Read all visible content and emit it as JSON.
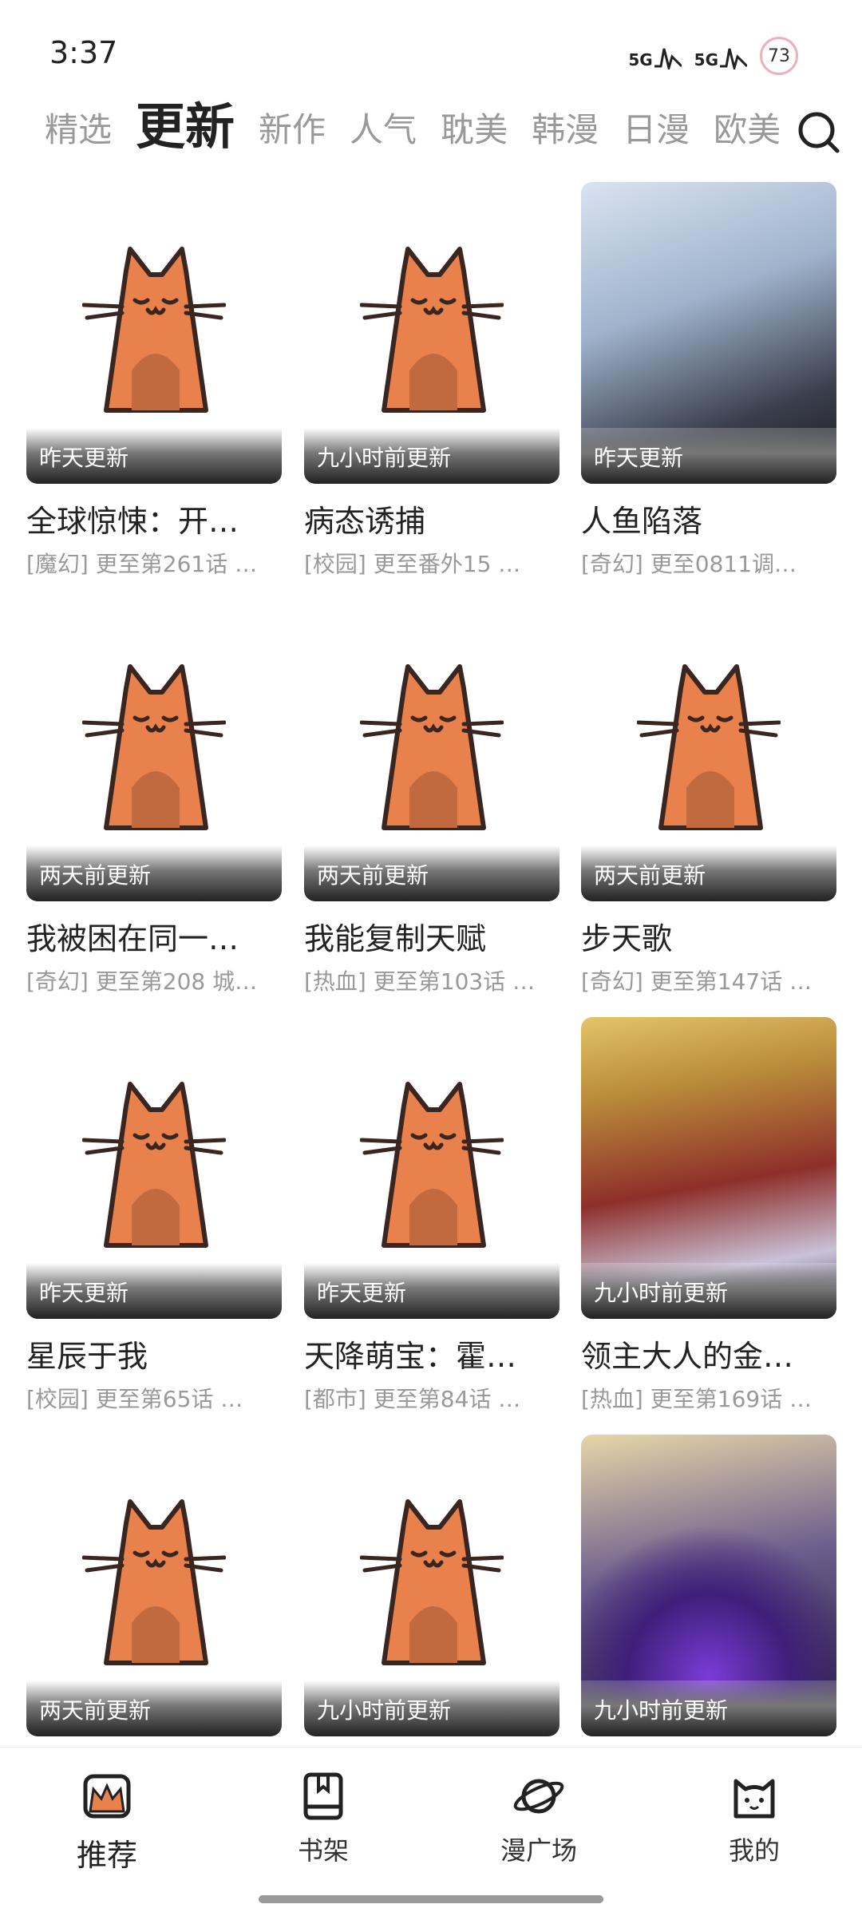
{
  "status_bar": {
    "time": "3:37",
    "signal_1": "5G",
    "signal_2": "5G",
    "battery": "73"
  },
  "tabs": [
    "精选",
    "更新",
    "新作",
    "人气",
    "耽美",
    "韩漫",
    "日漫",
    "欧美"
  ],
  "active_tab": "更新",
  "icons": {
    "search": "search-icon",
    "cat_placeholder": "cat-placeholder-icon"
  },
  "comics": [
    {
      "title": "全球惊悚：开…",
      "subtitle": "[魔幻] 更至第261话 …",
      "updated": "昨天更新",
      "cover": "placeholder"
    },
    {
      "title": "病态诱捕",
      "subtitle": "[校园] 更至番外15 …",
      "updated": "九小时前更新",
      "cover": "placeholder"
    },
    {
      "title": "人鱼陷落",
      "subtitle": "[奇幻] 更至0811调…",
      "updated": "昨天更新",
      "cover": "art-1"
    },
    {
      "title": "我被困在同一…",
      "subtitle": "[奇幻] 更至第208 城…",
      "updated": "两天前更新",
      "cover": "placeholder"
    },
    {
      "title": "我能复制天赋",
      "subtitle": "[热血] 更至第103话 …",
      "updated": "两天前更新",
      "cover": "placeholder"
    },
    {
      "title": "步天歌",
      "subtitle": "[奇幻] 更至第147话 …",
      "updated": "两天前更新",
      "cover": "placeholder"
    },
    {
      "title": "星辰于我",
      "subtitle": "[校园] 更至第65话 …",
      "updated": "昨天更新",
      "cover": "placeholder"
    },
    {
      "title": "天降萌宝：霍…",
      "subtitle": "[都市] 更至第84话 …",
      "updated": "昨天更新",
      "cover": "placeholder"
    },
    {
      "title": "领主大人的金…",
      "subtitle": "[热血] 更至第169话 …",
      "updated": "九小时前更新",
      "cover": "art-2"
    },
    {
      "title": "",
      "subtitle": "",
      "updated": "两天前更新",
      "cover": "placeholder"
    },
    {
      "title": "",
      "subtitle": "",
      "updated": "九小时前更新",
      "cover": "placeholder"
    },
    {
      "title": "",
      "subtitle": "",
      "updated": "九小时前更新",
      "cover": "art-3"
    }
  ],
  "bottom_nav": [
    {
      "label": "推荐",
      "icon": "recommend-icon",
      "active": true
    },
    {
      "label": "书架",
      "icon": "bookshelf-icon",
      "active": false
    },
    {
      "label": "漫广场",
      "icon": "planet-icon",
      "active": false
    },
    {
      "label": "我的",
      "icon": "cat-face-icon",
      "active": false
    }
  ],
  "colors": {
    "cat_orange": "#e8814b",
    "cat_outline": "#3a2620",
    "cat_belly": "#c26a3f",
    "text_primary": "#222222",
    "text_secondary": "#999999"
  }
}
